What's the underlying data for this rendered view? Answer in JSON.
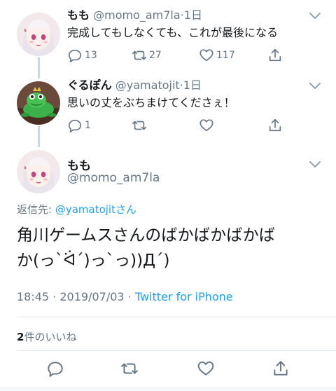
{
  "tweets": [
    {
      "name": "もも",
      "handle": "@momo_am7la",
      "dot": "·",
      "time": "1日",
      "text": "完成してもしなくても、これが最後になる",
      "reply_count": "13",
      "retweet_count": "27",
      "like_count": "117"
    },
    {
      "name": "ぐるぽん",
      "handle": "@yamatojit",
      "dot": "·",
      "time": "1日",
      "text": "思いの丈をぶちまけてくださぇ！",
      "reply_count": "1",
      "retweet_count": "",
      "like_count": ""
    }
  ],
  "main_tweet": {
    "name": "もも",
    "handle": "@momo_am7la",
    "reply_prefix": "返信先: ",
    "reply_handle": "@yamatojit",
    "reply_suffix": "さん",
    "text_line1": "角川ゲームスさんのばかばかばかば",
    "text_line2": "か(っ`ᐛ´)っ`っ))Д´)",
    "timestamp": "18:45 · 2019/07/03 · ",
    "source": "Twitter for iPhone",
    "likes_count": "2",
    "likes_label": "件のいいね"
  },
  "icons": {
    "reply": "reply-icon",
    "retweet": "retweet-icon",
    "like": "heart-icon",
    "share": "share-icon",
    "caret": "chevron-down-icon"
  },
  "colors": {
    "accent": "#1da1f2",
    "secondary_text": "#657786",
    "thread_line": "#ccd6dd",
    "icon": "#657786"
  }
}
